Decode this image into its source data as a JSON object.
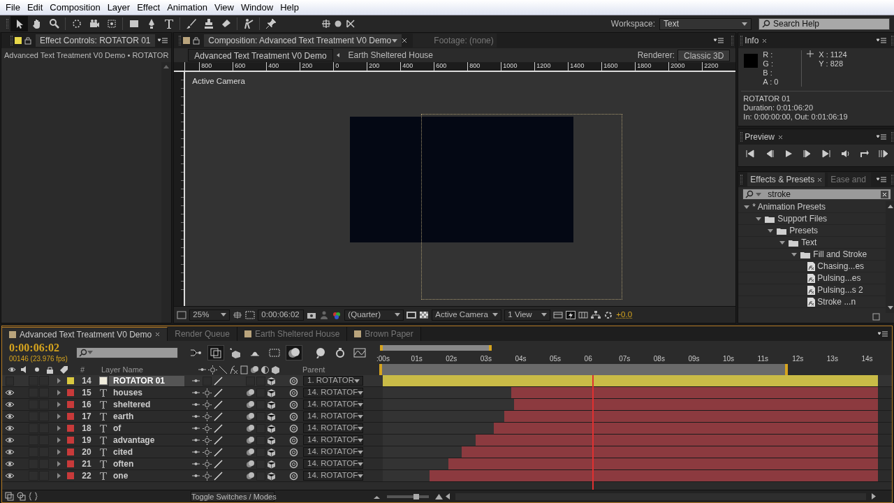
{
  "menu": [
    "File",
    "Edit",
    "Composition",
    "Layer",
    "Effect",
    "Animation",
    "View",
    "Window",
    "Help"
  ],
  "toolbar": {
    "workspace_label": "Workspace:",
    "workspace_value": "Text",
    "search_placeholder": "Search Help"
  },
  "effect_controls": {
    "tab": "Effect Controls: ROTATOR 01",
    "breadcrumb": "Advanced Text Treatment V0 Demo • ROTATOR"
  },
  "composition": {
    "tab": "Composition: Advanced Text Treatment V0 Demo",
    "footage_tab": "Footage: (none)",
    "breadcrumbs": [
      {
        "label": "Advanced Text Treatment V0 Demo",
        "selected": true
      },
      {
        "label": "Earth Sheltered House",
        "selected": false
      }
    ],
    "renderer_label": "Renderer:",
    "renderer_value": "Classic 3D",
    "ruler_labels": [
      "800",
      "600",
      "400",
      "200",
      "0",
      "200",
      "400",
      "600",
      "800",
      "1000",
      "1200",
      "1400",
      "1600",
      "1800",
      "2000",
      "2200"
    ],
    "camera_label": "Active Camera",
    "zoom": "25%",
    "timecode": "0:00:06:02",
    "resolution": "(Quarter)",
    "view": "Active Camera",
    "views": "1 View",
    "exposure": "+0.0"
  },
  "info": {
    "tab": "Info",
    "r": "R :",
    "g": "G :",
    "b": "B :",
    "a": "A : 0",
    "x": "X : 1124",
    "y": "Y : 828",
    "layer": "ROTATOR 01",
    "duration": "Duration: 0:01:06:20",
    "in_out": "In: 0:00:00:00, Out: 0:01:06:19"
  },
  "preview": {
    "tab": "Preview"
  },
  "effects_presets": {
    "tabs": [
      {
        "label": "Effects & Presets",
        "selected": true
      },
      {
        "label": "Ease and",
        "selected": false
      }
    ],
    "search": "stroke",
    "tree": [
      {
        "label": "* Animation Presets",
        "kind": "root",
        "expanded": true,
        "children": [
          {
            "label": "Support Files",
            "kind": "folder",
            "expanded": true,
            "children": [
              {
                "label": "Presets",
                "kind": "folder",
                "expanded": true,
                "children": [
                  {
                    "label": "Text",
                    "kind": "folder",
                    "expanded": true,
                    "children": [
                      {
                        "label": "Fill and Stroke",
                        "kind": "folder",
                        "expanded": true,
                        "children": [
                          {
                            "label": "Chasing...es",
                            "kind": "preset"
                          },
                          {
                            "label": "Pulsing...es",
                            "kind": "preset"
                          },
                          {
                            "label": "Pulsing...s 2",
                            "kind": "preset"
                          },
                          {
                            "label": "Stroke ...n",
                            "kind": "preset"
                          }
                        ]
                      }
                    ]
                  }
                ]
              }
            ]
          }
        ]
      }
    ]
  },
  "timeline": {
    "tabs": [
      {
        "label": "Advanced Text Treatment V0 Demo",
        "selected": true
      },
      {
        "label": "Render Queue",
        "selected": false
      },
      {
        "label": "Earth Sheltered House",
        "selected": false
      },
      {
        "label": "Brown Paper",
        "selected": false
      }
    ],
    "timecode": "0:00:06:02",
    "frame_info": "00146 (23.976 fps)",
    "column_number": "#",
    "column_name": "Layer Name",
    "column_parent": "Parent",
    "ticks": [
      ":00s",
      "01s",
      "02s",
      "03s",
      "04s",
      "05s",
      "06",
      "07s",
      "08s",
      "09s",
      "10s",
      "11s",
      "12s",
      "13s",
      "14s"
    ],
    "layers": [
      {
        "number": "14",
        "name": "ROTATOR 01",
        "kind": "solid",
        "color": "#d9c840",
        "selected": true,
        "visible": false,
        "parent": "1. ROTATOR",
        "level": 1
      },
      {
        "number": "15",
        "name": "houses",
        "kind": "text",
        "color": "#c83a3a",
        "selected": false,
        "visible": true,
        "parent": "14. ROTATOF",
        "level": 0.74
      },
      {
        "number": "16",
        "name": "sheltered",
        "kind": "text",
        "color": "#c83a3a",
        "selected": false,
        "visible": true,
        "parent": "14. ROTATOF",
        "level": 0.735
      },
      {
        "number": "17",
        "name": "earth",
        "kind": "text",
        "color": "#c83a3a",
        "selected": false,
        "visible": true,
        "parent": "14. ROTATOF",
        "level": 0.755
      },
      {
        "number": "18",
        "name": "of",
        "kind": "text",
        "color": "#c83a3a",
        "selected": false,
        "visible": true,
        "parent": "14. ROTATOF",
        "level": 0.776
      },
      {
        "number": "19",
        "name": "advantage",
        "kind": "text",
        "color": "#c83a3a",
        "selected": false,
        "visible": true,
        "parent": "14. ROTATOF",
        "level": 0.812
      },
      {
        "number": "20",
        "name": "cited",
        "kind": "text",
        "color": "#c83a3a",
        "selected": false,
        "visible": true,
        "parent": "14. ROTATOF",
        "level": 0.84
      },
      {
        "number": "21",
        "name": "often",
        "kind": "text",
        "color": "#c83a3a",
        "selected": false,
        "visible": true,
        "parent": "14. ROTATOF",
        "level": 0.867
      },
      {
        "number": "22",
        "name": "one",
        "kind": "text",
        "color": "#c83a3a",
        "selected": false,
        "visible": true,
        "parent": "14. ROTATOF",
        "level": 0.905
      }
    ],
    "toggle_label": "Toggle Switches / Modes",
    "zoom_slider": {
      "level": 0.7
    }
  }
}
